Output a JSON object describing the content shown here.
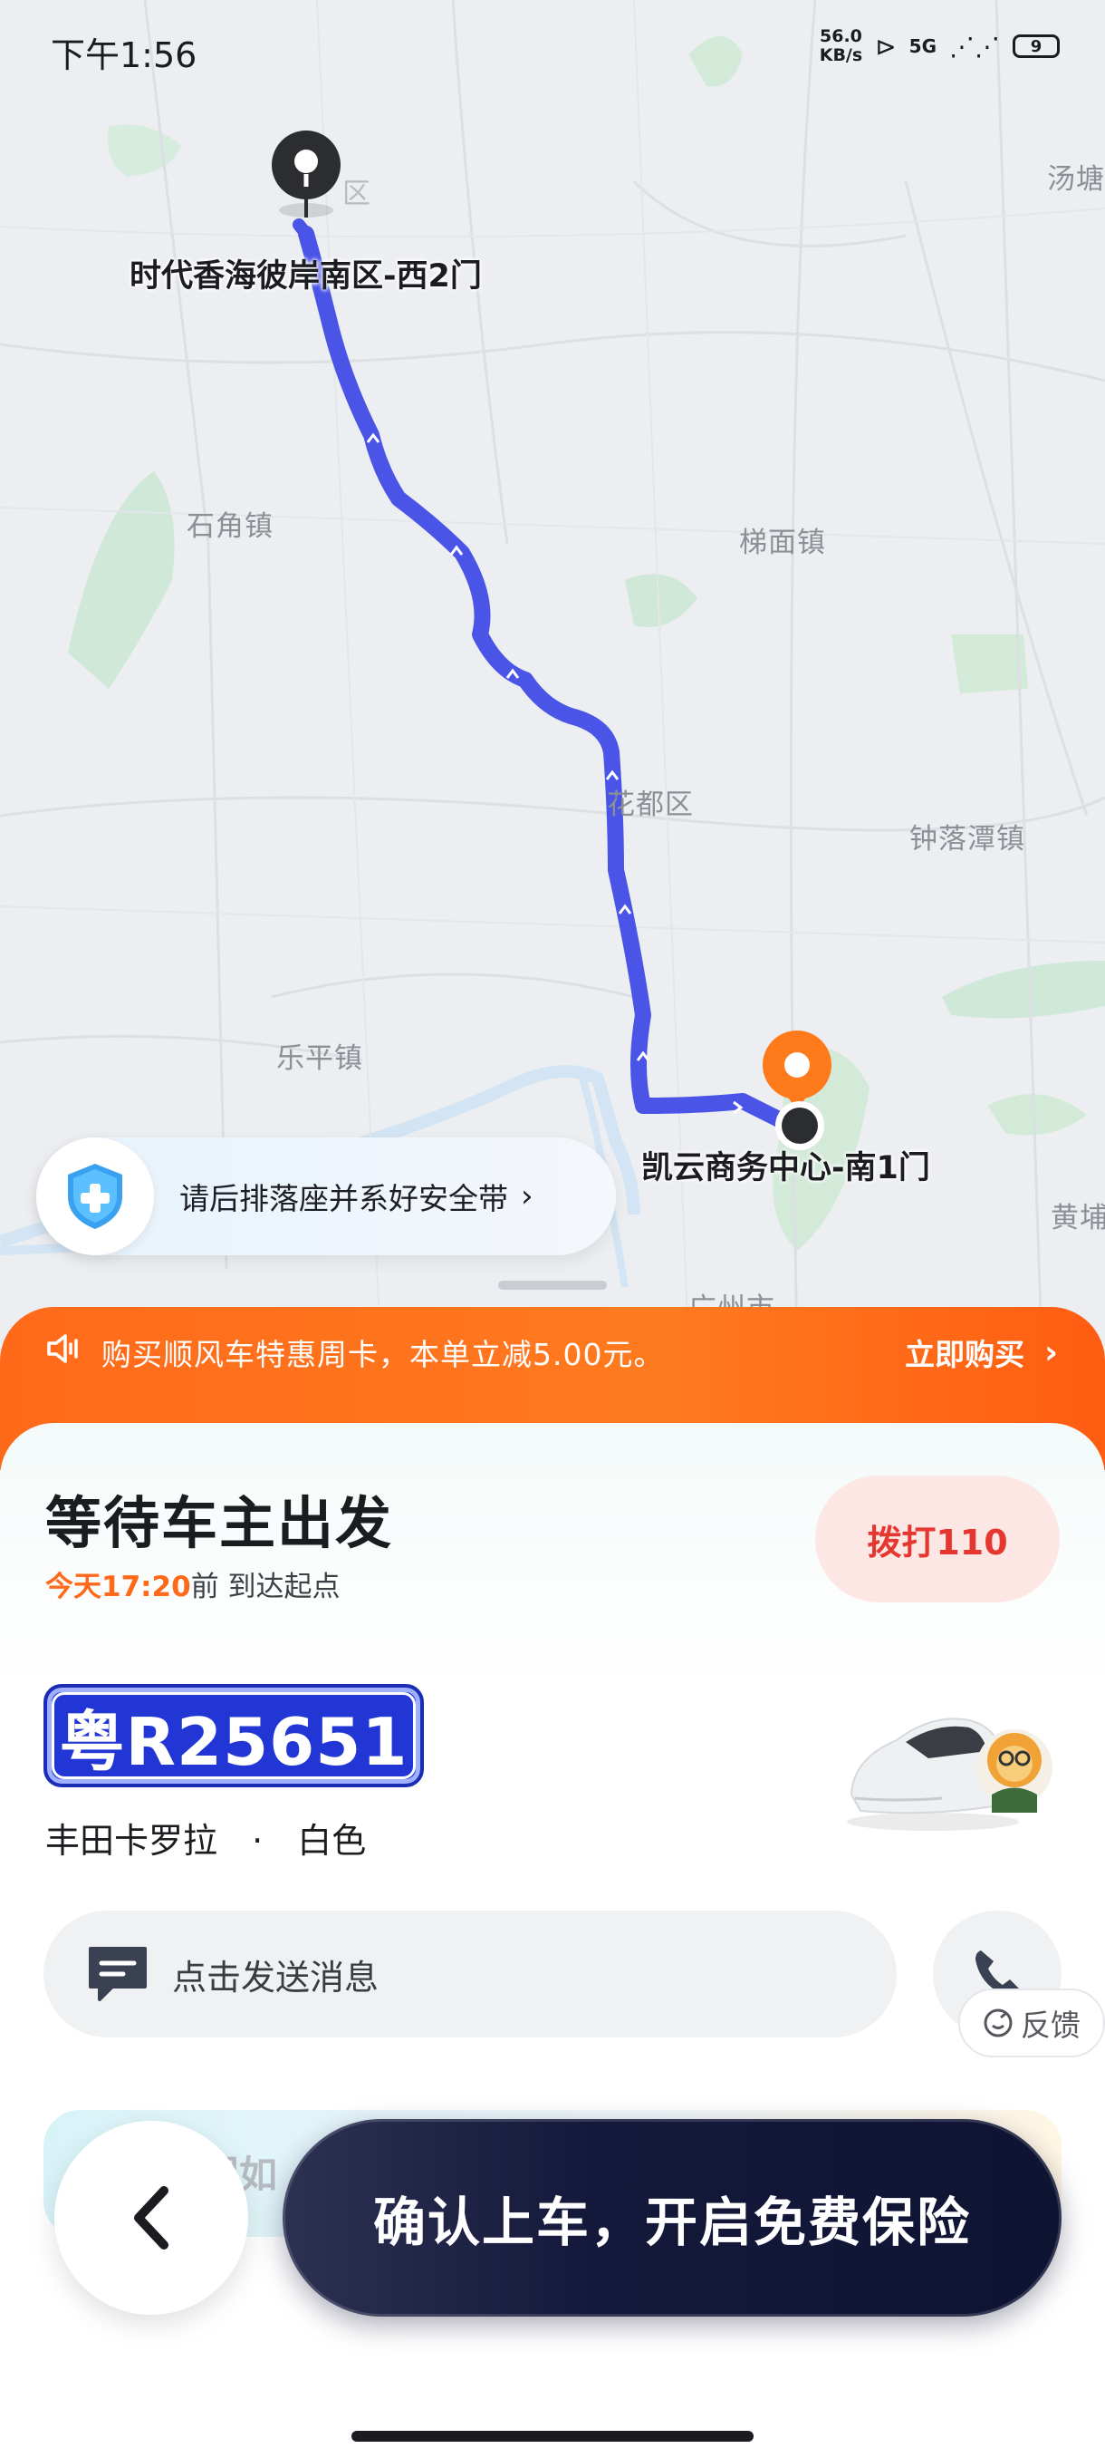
{
  "status_bar": {
    "time": "下午1:56",
    "net_speed_value": "56.0",
    "net_speed_unit": "KB/s",
    "signal": "5G",
    "battery": "9"
  },
  "map": {
    "place_labels": {
      "tangtang": "汤塘",
      "shijiao": "石角镇",
      "timian": "梯面镇",
      "huadu": "花都区",
      "zhongluotan": "钟落潭镇",
      "leping": "乐平镇",
      "huangpu": "黄埔",
      "guangzhou": "广州市",
      "district_top": "区"
    },
    "origin_label": "时代香海彼岸南区-西2门",
    "destination_label": "凯云商务中心-南1门",
    "route_color": "#4a55e8",
    "safety_tip": "请后排落座并系好安全带"
  },
  "promo": {
    "text": "购买顺风车特惠周卡，本单立减5.00元。",
    "action": "立即购买"
  },
  "trip": {
    "status_title": "等待车主出发",
    "eta_time": "今天17:20",
    "eta_suffix": "前 到达起点",
    "call_button": "拨打110",
    "plate": "粤R25651",
    "car_model": "丰田卡罗拉",
    "car_separator": "·",
    "car_color": "白色",
    "message_placeholder": "点击发送消息",
    "feedback": "反馈",
    "notice_partial": "当前行程如",
    "confirm_button": "确认上车，开启免费保险"
  }
}
